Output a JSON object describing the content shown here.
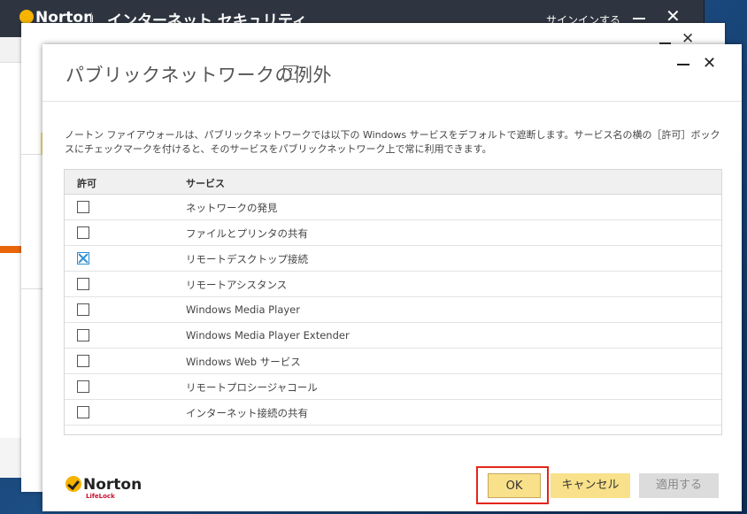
{
  "main_window": {
    "brand": "Norton",
    "title": "インターネット セキュリティ",
    "signin": "サインインする",
    "close_glyph": "✕"
  },
  "mid_window": {
    "close_glyph": "✕"
  },
  "dialog": {
    "title": "パブリックネットワークの例外",
    "help_glyph": "?",
    "close_glyph": "✕",
    "description": "ノートン ファイアウォールは、パブリックネットワークでは以下の Windows サービスをデフォルトで遮断します。サービス名の横の［許可］ボックスにチェックマークを付けると、そのサービスをパブリックネットワーク上で常に利用できます。",
    "table": {
      "col_allow": "許可",
      "col_service": "サービス",
      "rows": [
        {
          "label": "ネットワークの発見",
          "checked": false
        },
        {
          "label": "ファイルとプリンタの共有",
          "checked": false
        },
        {
          "label": "リモートデスクトップ接続",
          "checked": true
        },
        {
          "label": "リモートアシスタンス",
          "checked": false
        },
        {
          "label": "Windows Media Player",
          "checked": false
        },
        {
          "label": "Windows Media Player Extender",
          "checked": false
        },
        {
          "label": "Windows Web サービス",
          "checked": false
        },
        {
          "label": "リモートプロシージャコール",
          "checked": false
        },
        {
          "label": "インターネット接続の共有",
          "checked": false
        }
      ]
    },
    "footer": {
      "logo_text": "Norton",
      "logo_sub": "LifeLock",
      "ok_label": "OK",
      "cancel_label": "キャンセル",
      "apply_label": "適用する"
    }
  },
  "colors": {
    "accent_yellow": "#f9e08a",
    "highlight_red": "#e3251b",
    "check_blue": "#2b8ed4",
    "norton_gold": "#f6b400"
  }
}
